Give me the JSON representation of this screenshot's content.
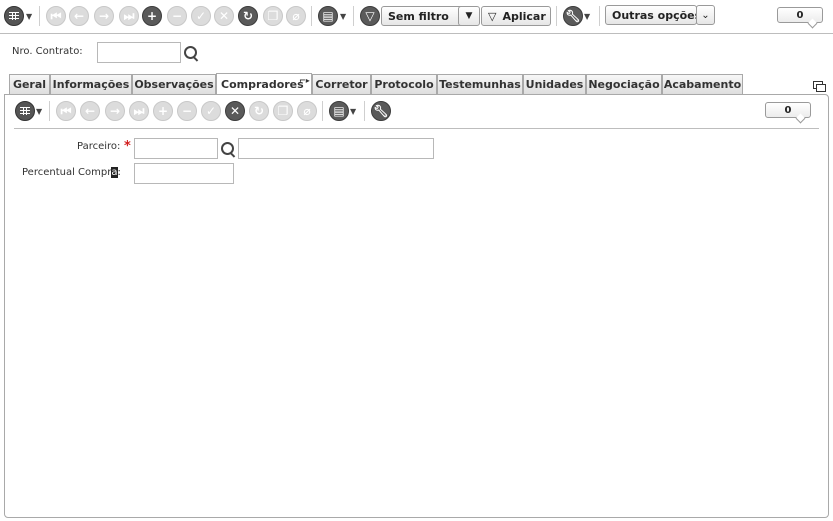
{
  "toolbar": {
    "filter_label": "Sem filtro",
    "apply_label": "Aplicar",
    "more_options_label": "Outras opções",
    "record_count": "0"
  },
  "contract": {
    "label": "Nro. Contrato:",
    "value": ""
  },
  "tabs": [
    {
      "label": "Geral"
    },
    {
      "label": "Informações"
    },
    {
      "label": "Observações"
    },
    {
      "label": "Compradores"
    },
    {
      "label": "Corretor"
    },
    {
      "label": "Protocolo"
    },
    {
      "label": "Testemunhas"
    },
    {
      "label": "Unidades"
    },
    {
      "label": "Negociação"
    },
    {
      "label": "Acabamento"
    }
  ],
  "active_tab": "Compradores",
  "inner_toolbar": {
    "record_count": "0"
  },
  "form": {
    "partner_label": "Parceiro:",
    "partner_code": "",
    "partner_name": "",
    "percent_label_a": "Percentual Compr",
    "percent_label_cursor": "a",
    "percent_label_b": ":",
    "percent_value": ""
  },
  "colors": {
    "required": "#d21d1d",
    "border": "#a9a9a9"
  }
}
